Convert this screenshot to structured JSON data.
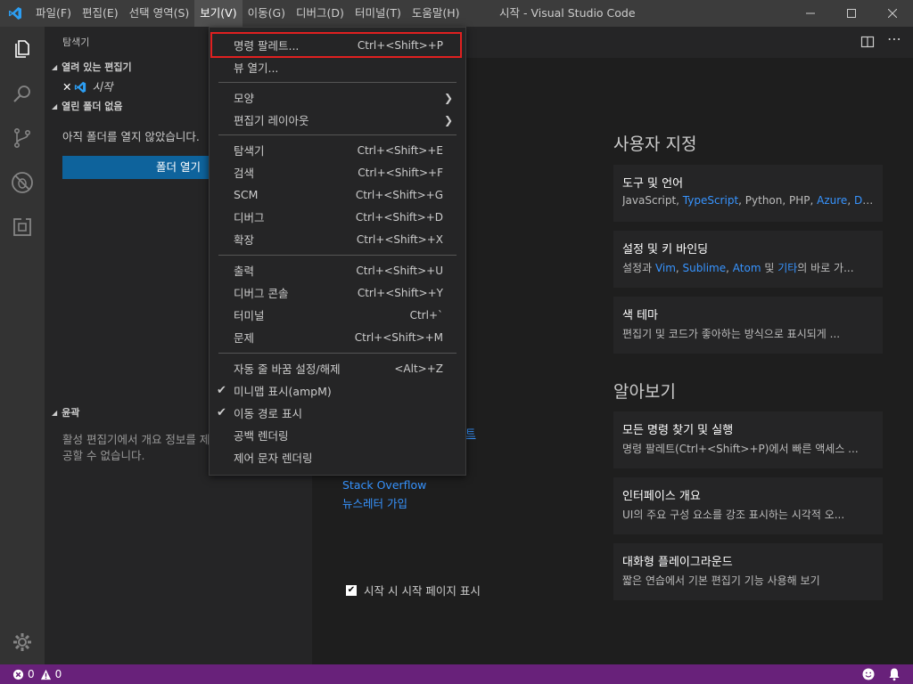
{
  "window": {
    "title": "시작 - Visual Studio Code"
  },
  "menubar": [
    {
      "label": "파일(F)"
    },
    {
      "label": "편집(E)"
    },
    {
      "label": "선택 영역(S)"
    },
    {
      "label": "보기(V)"
    },
    {
      "label": "이동(G)"
    },
    {
      "label": "디버그(D)"
    },
    {
      "label": "터미널(T)"
    },
    {
      "label": "도움말(H)"
    }
  ],
  "activitybar": {
    "items": [
      "explorer-icon",
      "search-icon",
      "source-control-icon",
      "debug-icon",
      "extensions-icon"
    ],
    "bottom": "gear-icon"
  },
  "sidebar": {
    "title": "탐색기",
    "open_editors_header": "열려 있는 편집기",
    "open_editor_item": "시작",
    "no_folder_header": "열린 폴더 없음",
    "no_folder_text": "아직 폴더를 열지 않았습니다.",
    "open_folder_button": "폴더 열기",
    "outline_header": "윤곽",
    "outline_text": "활성 편집기에서 개요 정보를 제공할 수 없습니다."
  },
  "view_menu": {
    "items": [
      {
        "label": "명령 팔레트...",
        "key": "Ctrl+<Shift>+P"
      },
      {
        "label": "뷰 열기...",
        "key": ""
      },
      {
        "label": "모양",
        "submenu": true
      },
      {
        "label": "편집기 레이아웃",
        "submenu": true
      },
      {
        "label": "탐색기",
        "key": "Ctrl+<Shift>+E"
      },
      {
        "label": "검색",
        "key": "Ctrl+<Shift>+F"
      },
      {
        "label": "SCM",
        "key": "Ctrl+<Shift>+G"
      },
      {
        "label": "디버그",
        "key": "Ctrl+<Shift>+D"
      },
      {
        "label": "확장",
        "key": "Ctrl+<Shift>+X"
      },
      {
        "label": "출력",
        "key": "Ctrl+<Shift>+U"
      },
      {
        "label": "디버그 콘솔",
        "key": "Ctrl+<Shift>+Y"
      },
      {
        "label": "터미널",
        "key": "Ctrl+`"
      },
      {
        "label": "문제",
        "key": "Ctrl+<Shift>+M"
      },
      {
        "label": "자동 줄 바꿈 설정/해제",
        "key": "<Alt>+Z"
      },
      {
        "label": "미니맵 표시(ampM)",
        "checked": true
      },
      {
        "label": "이동 경로 표시",
        "checked": true
      },
      {
        "label": "공백 렌더링"
      },
      {
        "label": "제어 문자 렌더링"
      }
    ]
  },
  "welcome": {
    "customize_title": "사용자 지정",
    "learn_title": "알아보기",
    "cards": [
      {
        "title": "도구 및 언어",
        "desc_parts": [
          "JavaScript, ",
          "TypeScript",
          ", Python, PHP, ",
          "Azure",
          ", ",
          "Doc..."
        ]
      },
      {
        "title": "설정 및 키 바인딩",
        "desc_parts": [
          "설정과 ",
          "Vim",
          ", ",
          "Sublime",
          ", ",
          "Atom",
          " 및 ",
          "기타",
          "의 바로 가..."
        ]
      },
      {
        "title": "색 테마",
        "desc": "편집기 및 코드가 좋아하는 방식으로 표시되게 ..."
      },
      {
        "title": "모든 명령 찾기 및 실행",
        "desc": "명령 팔레트(Ctrl+<Shift>+P)에서 빠른 액세스 ..."
      },
      {
        "title": "인터페이스 개요",
        "desc": "UI의 주요 구성 요소를 강조 표시하는 시각적 오..."
      },
      {
        "title": "대화형 플레이그라운드",
        "desc": "짧은 연습에서 기본 편집기 기능 사용해 보기"
      }
    ],
    "help_links": [
      "트",
      "Stack Overflow",
      "뉴스레터 가입"
    ],
    "show_on_startup": "시작 시 시작 페이지 표시"
  },
  "statusbar": {
    "errors": "0",
    "warnings": "0"
  },
  "colors": {
    "accent": "#0e639c",
    "status": "#68217a",
    "link": "#3794ff",
    "highlight": "#e02020"
  }
}
